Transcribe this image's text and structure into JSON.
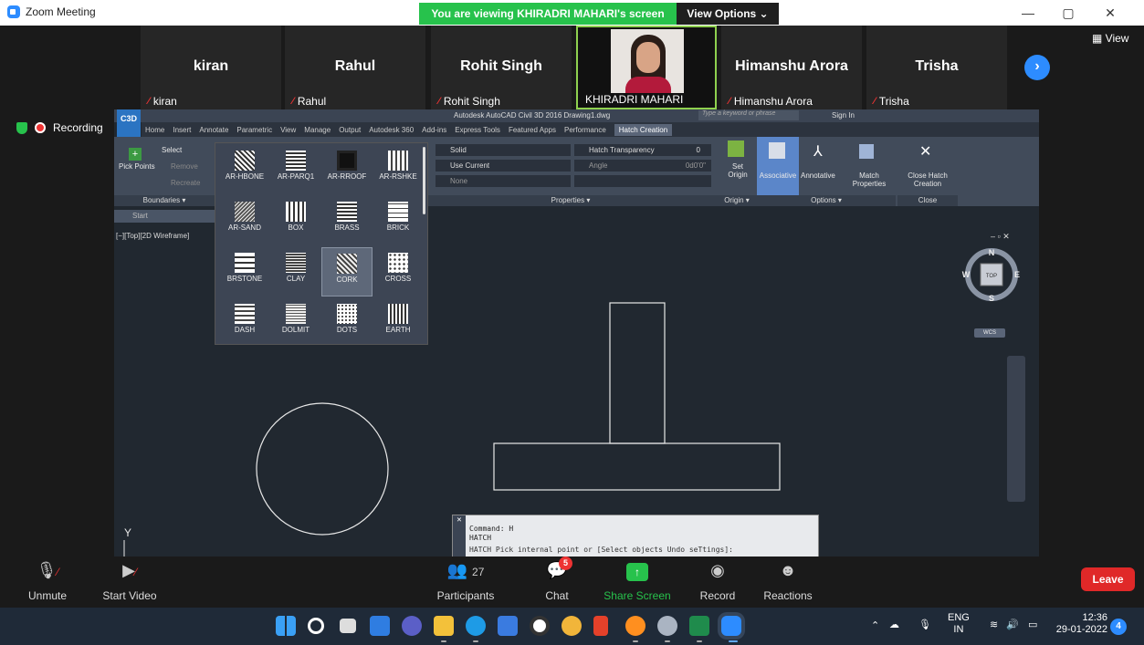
{
  "window": {
    "title": "Zoom Meeting",
    "minimize": "—",
    "maximize": "▢",
    "close": "✕"
  },
  "banner": {
    "viewing": "You are viewing KHIRADRI MAHARI's screen",
    "view_options": "View Options ⌄",
    "view_label": "View"
  },
  "participants": [
    {
      "big": "kiran",
      "small": "kiran"
    },
    {
      "big": "Rahul",
      "small": "Rahul"
    },
    {
      "big": "Rohit Singh",
      "small": "Rohit Singh"
    },
    {
      "big": "",
      "small": "KHIRADRI MAHARI"
    },
    {
      "big": "Himanshu Arora",
      "small": "Himanshu Arora"
    },
    {
      "big": "Trisha",
      "small": "Trisha"
    }
  ],
  "recording": {
    "label": "Recording"
  },
  "autocad": {
    "logo": "C3D",
    "title": "Autodesk AutoCAD Civil 3D 2016   Drawing1.dwg",
    "search_placeholder": "Type a keyword or phrase",
    "sign_in": "Sign In",
    "tabs": [
      "Home",
      "Insert",
      "Annotate",
      "Parametric",
      "View",
      "Manage",
      "Output",
      "Autodesk 360",
      "Add-ins",
      "Express Tools",
      "Featured Apps",
      "Performance",
      "Hatch Creation"
    ],
    "active_tab": "Hatch Creation",
    "ribbon": {
      "pick_points": "Pick Points",
      "select": "Select",
      "remove": "Remove",
      "recreate": "Recreate",
      "boundaries": "Boundaries ▾",
      "hatch_type": "Solid",
      "use_current": "Use Current",
      "none": "None",
      "hatch_transparency": "Hatch Transparency",
      "transparency_value": "0",
      "angle": "Angle",
      "angle_value": "0d0'0\"",
      "properties": "Properties ▾",
      "set_origin": "Set Origin",
      "origin": "Origin ▾",
      "associative": "Associative",
      "annotative": "Annotative",
      "match_properties": "Match Properties",
      "options": "Options ▾",
      "close_hatch": "Close Hatch Creation",
      "close": "Close"
    },
    "start_tab": "Start",
    "viewport_label": "[−][Top][2D Wireframe]",
    "viewport_controls": "–  ▫  ✕",
    "view_cube": {
      "n": "N",
      "s": "S",
      "e": "E",
      "w": "W",
      "top": "TOP",
      "wcs": "WCS"
    },
    "patterns": [
      "AR-HBONE",
      "AR-PARQ1",
      "AR-RROOF",
      "AR-RSHKE",
      "AR-SAND",
      "BOX",
      "BRASS",
      "BRICK",
      "BRSTONE",
      "CLAY",
      "CORK",
      "CROSS",
      "DASH",
      "DOLMIT",
      "DOTS",
      "EARTH"
    ],
    "selected_pattern": "CORK",
    "ucs_y": "Y",
    "command": {
      "close": "✕",
      "line1": "Command: H",
      "line2": "HATCH",
      "line3": "HATCH Pick internal point or [Select objects Undo seTtings]:"
    }
  },
  "toolbar": {
    "unmute": "Unmute",
    "start_video": "Start Video",
    "participants": "Participants",
    "participant_count": "27",
    "chat": "Chat",
    "chat_badge": "5",
    "share_screen": "Share Screen",
    "record": "Record",
    "reactions": "Reactions",
    "leave": "Leave"
  },
  "taskbar": {
    "lang_top": "ENG",
    "lang_bottom": "IN",
    "time": "12:36",
    "date": "29-01-2022",
    "notifications": "4",
    "apps": [
      "windows",
      "search",
      "task-view",
      "widgets",
      "teams",
      "file-explorer",
      "edge",
      "store",
      "chrome",
      "chrome-beta",
      "office",
      "firefox",
      "settings",
      "excel",
      "zoom"
    ]
  },
  "colors": {
    "zoom_blue": "#2d8cff",
    "share_green": "#27c24c",
    "leave_red": "#e02828",
    "active_speaker": "#8fd14f"
  }
}
